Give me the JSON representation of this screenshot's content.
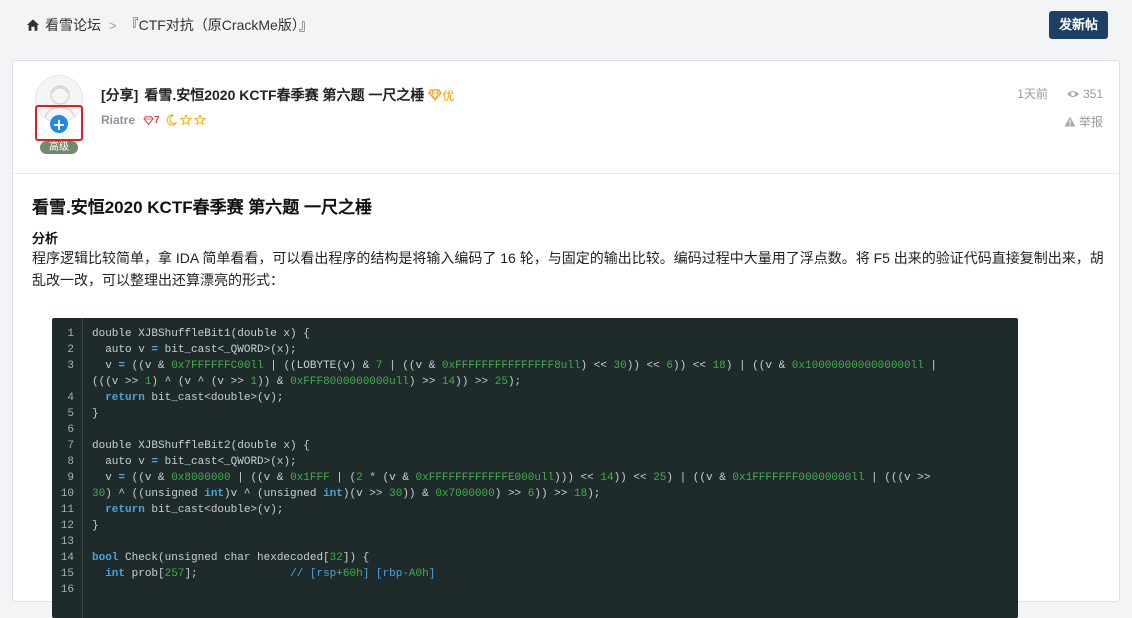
{
  "breadcrumb": {
    "home": "看雪论坛",
    "separator": ">",
    "section": "『CTF对抗（原CrackMe版）』"
  },
  "toolbar": {
    "new_post_label": "发新帖"
  },
  "post": {
    "prefix": "[分享]",
    "title": "看雪.安恒2020 KCTF春季赛 第六题 一尺之棰",
    "quality_tag": "优",
    "author": "Riatre",
    "rank": "7",
    "level_badge": "高级",
    "time": "1天前",
    "views": "351",
    "report_label": "举报"
  },
  "content": {
    "heading": "看雪.安恒2020 KCTF春季赛 第六题 一尺之棰",
    "section_heading": "分析",
    "paragraph": "程序逻辑比较简单，拿 IDA 简单看看，可以看出程序的结构是将输入编码了 16 轮，与固定的输出比较。编码过程中大量用了浮点数。将 F5 出来的验证代码直接复制出来，胡乱改一改，可以整理出还算漂亮的形式："
  },
  "code": {
    "line_numbers": [
      "1",
      "2",
      "3",
      "",
      "4",
      "5",
      "6",
      "7",
      "8",
      "9",
      "10",
      "11",
      "12",
      "13",
      "14",
      "15",
      "16"
    ],
    "lines": [
      "double XJBShuffleBit1(double x) {",
      "  auto v = bit_cast<_QWORD>(x);",
      "  v = ((v & 0x7FFFFFFC00ll | ((LOBYTE(v) & 7 | ((v & 0xFFFFFFFFFFFFFFF8ull) << 30)) << 6)) << 18) | ((v & 0x1000000000000000ll |",
      "(((v >> 1) ^ (v ^ (v >> 1)) & 0xFFF8000000000ull) >> 14)) >> 25);",
      "  return bit_cast<double>(v);",
      "}",
      "",
      "double XJBShuffleBit2(double x) {",
      "  auto v = bit_cast<_QWORD>(x);",
      "  v = ((v & 0x8000000 | ((v & 0x1FFF | (2 * (v & 0xFFFFFFFFFFFFE000ull))) << 14)) << 25) | ((v & 0x1FFFFFFF00000000ll | (((v >>",
      "30) ^ ((unsigned int)v ^ (unsigned int)(v >> 30)) & 0x7000000) >> 6)) >> 18);",
      "  return bit_cast<double>(v);",
      "}",
      "",
      "bool Check(unsigned char hexdecoded[32]) {",
      "  int prob[257];              // [rsp+60h] [rbp-A0h]"
    ]
  }
}
